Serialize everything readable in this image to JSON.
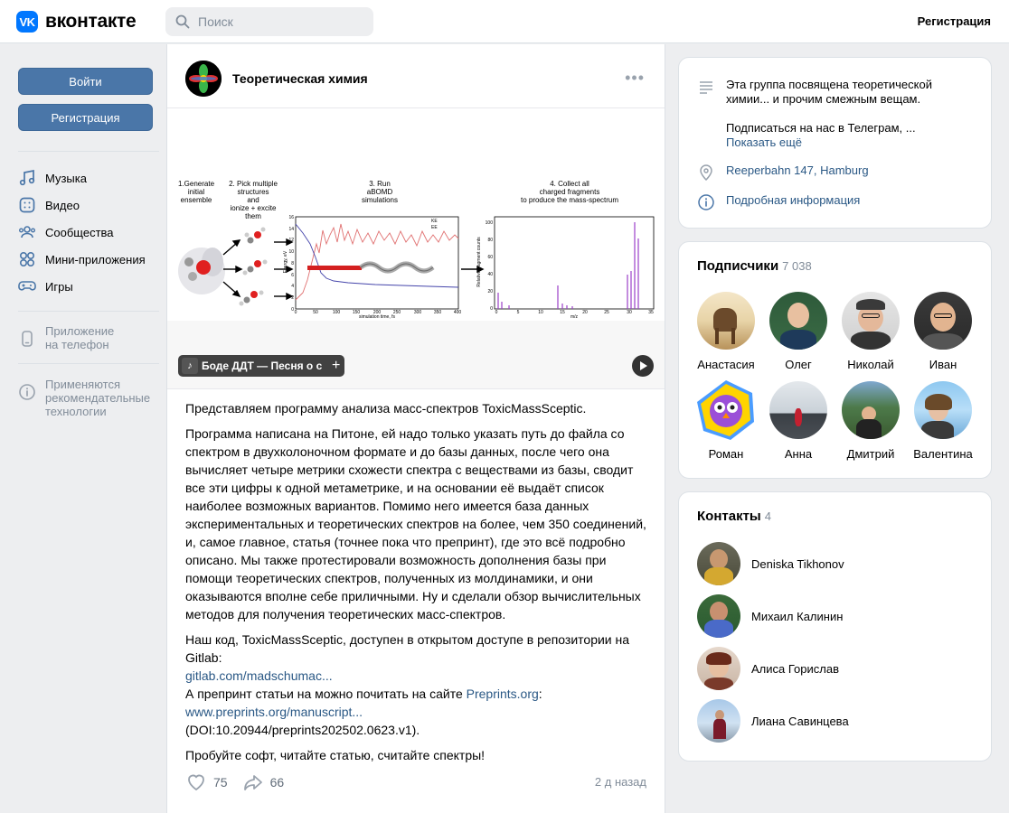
{
  "header": {
    "logo_mark": "VK",
    "logo_text": "вконтакте",
    "search_placeholder": "Поиск",
    "register": "Регистрация"
  },
  "sidebar": {
    "login_button": "Войти",
    "register_button": "Регистрация",
    "items": [
      {
        "label": "Музыка",
        "icon": "music-icon"
      },
      {
        "label": "Видео",
        "icon": "video-icon"
      },
      {
        "label": "Сообщества",
        "icon": "communities-icon"
      },
      {
        "label": "Мини-приложения",
        "icon": "mini-apps-icon"
      },
      {
        "label": "Игры",
        "icon": "games-icon"
      }
    ],
    "app_line1": "Приложение",
    "app_line2": "на телефон",
    "rec_line1": "Применяются",
    "rec_line2": "рекомендательные",
    "rec_line3": "технологии"
  },
  "post": {
    "group_name": "Теоретическая химия",
    "audio_text": "Боде   ДДТ — Песня о с",
    "paragraphs": [
      "Представляем программу анализа масс-спектров ToxicMassSceptic.",
      "Программа написана на Питоне, ей надо только указать путь до файла со спектром в двухколоночном формате и до базы данных, после чего она вычисляет четыре метрики схожести спектра с веществами из базы, сводит все эти цифры к одной метаметрике, и на основании её выдаёт список наиболее возможных вариантов. Помимо него имеется база данных экспериментальных и теоретических спектров на более, чем 350 соединений, и, самое главное, статья (точнее пока что препринт), где это всё подробно описано. Мы также протестировали возможность дополнения базы при помощи теоретических спектров, полученных из молдинамики, и они оказываются вполне себе приличными. Ну и сделали обзор вычислительных методов для получения теоретических масс-спектров."
    ],
    "code_intro": "Наш код, ToxicMassSceptic, доступен в открытом доступе в репозитории на Gitlab:",
    "gitlab_link": "gitlab.com/madschumac...",
    "preprint_intro": "А препринт статьи на можно почитать на сайте ",
    "preprints_site": "Preprints.org",
    "colon": ":",
    "preprint_link": "www.preprints.org/manuscript...",
    "doi": "(DOI:10.20944/preprints202502.0623.v1).",
    "closing": "Пробуйте софт, читайте статью, считайте спектры!",
    "likes": "75",
    "shares": "66",
    "time": "2 д назад"
  },
  "figure": {
    "step1": [
      "1.Generate",
      "initial",
      "ensemble"
    ],
    "step2": [
      "2. Pick multiple",
      "structures",
      "and",
      "ionize + excite",
      "them"
    ],
    "step3": [
      "3. Run",
      "aBOMD",
      "simulations"
    ],
    "step4": [
      "4. Collect all",
      "charged fragments",
      "to produce the mass-spectrum"
    ],
    "plot1_xlabel": "simulation time, fs",
    "plot1_ylabel": "Energy, eV",
    "plot1_legend": [
      "KE",
      "EE"
    ],
    "plot1_xticks": [
      "0",
      "50",
      "100",
      "150",
      "200",
      "250",
      "300",
      "350",
      "400"
    ],
    "plot1_yticks": [
      "16",
      "14",
      "12",
      "10",
      "8",
      "6",
      "4",
      "2",
      "0"
    ],
    "plot2_xlabel": "m/z",
    "plot2_ylabel": "Relative fragment counts",
    "plot2_xticks": [
      "0",
      "5",
      "10",
      "15",
      "20",
      "25",
      "30",
      "35"
    ],
    "plot2_yticks": [
      "100",
      "80",
      "60",
      "40",
      "20",
      "0"
    ]
  },
  "about": {
    "description_line": "Эта группа посвящена теоретической химии... и прочим смежным вещам.",
    "telegram": "Подписаться на нас в Телеграм, ... ",
    "show_more": "Показать ещё",
    "address": "Reeperbahn 147, Hamburg",
    "details": "Подробная информация"
  },
  "subscribers": {
    "title": "Подписчики",
    "count": "7 038",
    "people": [
      "Анастасия",
      "Олег",
      "Николай",
      "Иван",
      "Роман",
      "Анна",
      "Дмитрий",
      "Валентина"
    ]
  },
  "contacts": {
    "title": "Контакты",
    "count": "4",
    "people": [
      "Deniska Tikhonov",
      "Михаил Калинин",
      "Алиса Горислав",
      "Лиана Савинцева"
    ]
  },
  "colors": {
    "accent": "#4a76a8",
    "link": "#2a5885",
    "vk_blue": "#0077ff",
    "muted": "#818c99"
  }
}
